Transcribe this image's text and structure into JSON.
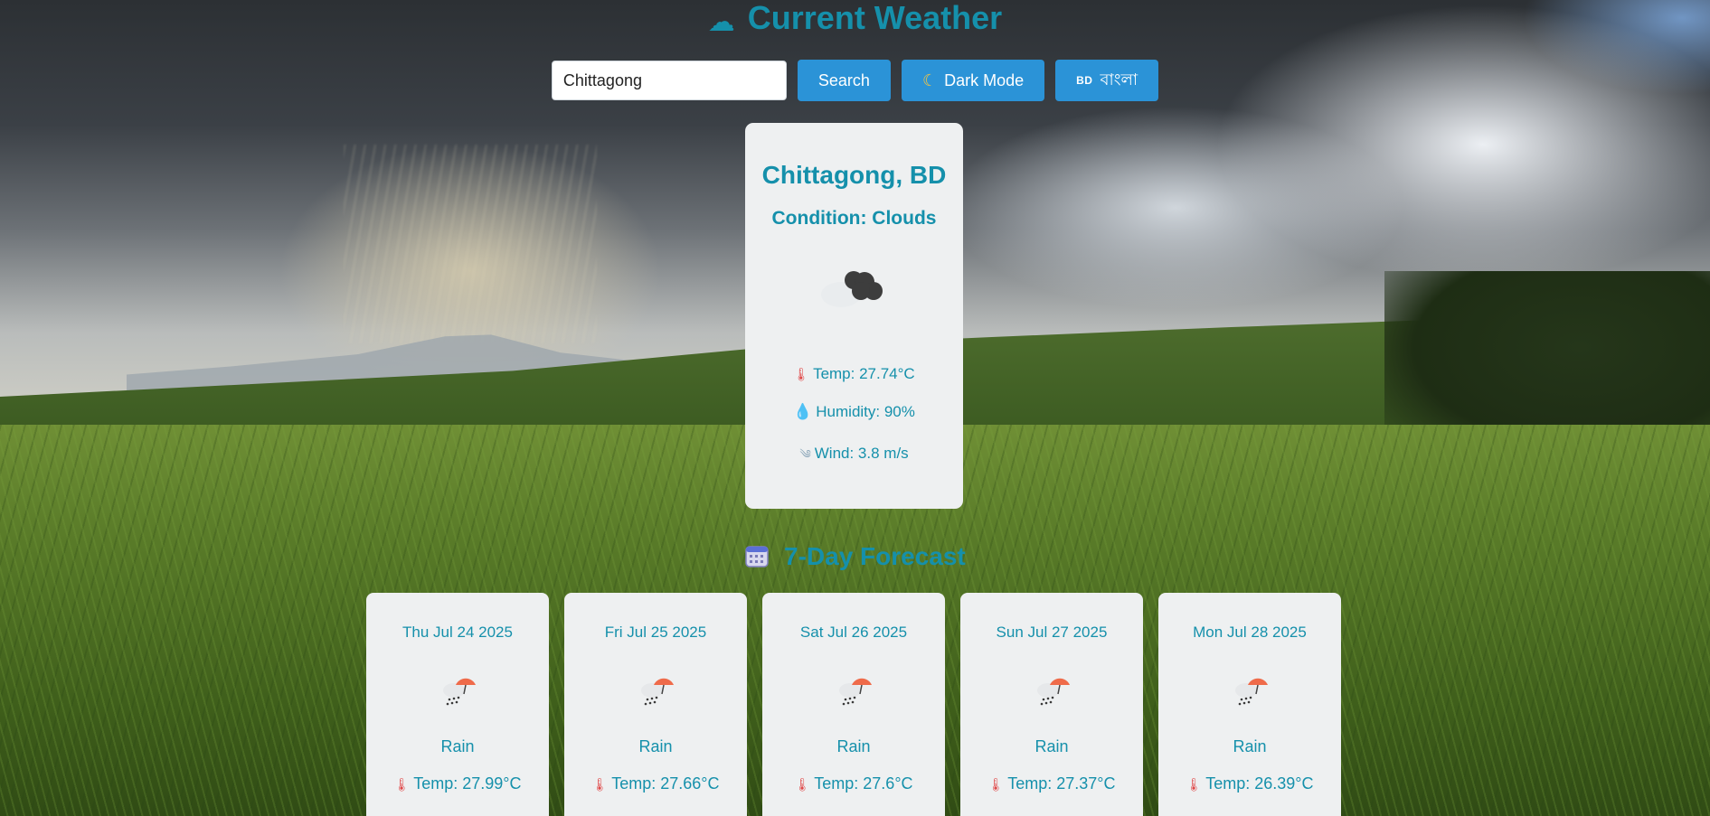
{
  "header": {
    "title": "Current Weather",
    "icon": "cloud-icon"
  },
  "search": {
    "value": "Chittagong",
    "button_label": "Search"
  },
  "toggles": {
    "dark_mode_label": "Dark Mode",
    "dark_mode_icon": "moon-icon",
    "language_flag": "BD",
    "language_label": "বাংলা"
  },
  "current": {
    "location": "Chittagong, BD",
    "condition": "Condition: Clouds",
    "icon": "clouds-icon",
    "temp": "Temp: 27.74°C",
    "humidity": "Humidity: 90%",
    "wind": "Wind: 3.8 m/s"
  },
  "forecast": {
    "title": "7-Day Forecast",
    "icon": "calendar-icon",
    "days": [
      {
        "date": "Thu Jul 24 2025",
        "condition": "Rain",
        "temp": "Temp: 27.99°C",
        "icon": "rain-icon"
      },
      {
        "date": "Fri Jul 25 2025",
        "condition": "Rain",
        "temp": "Temp: 27.66°C",
        "icon": "rain-icon"
      },
      {
        "date": "Sat Jul 26 2025",
        "condition": "Rain",
        "temp": "Temp: 27.6°C",
        "icon": "rain-icon"
      },
      {
        "date": "Sun Jul 27 2025",
        "condition": "Rain",
        "temp": "Temp: 27.37°C",
        "icon": "rain-icon"
      },
      {
        "date": "Mon Jul 28 2025",
        "condition": "Rain",
        "temp": "Temp: 26.39°C",
        "icon": "rain-icon"
      }
    ]
  },
  "colors": {
    "accent": "#1590ab",
    "button": "#2b93d7",
    "card": "#eef0f1"
  }
}
